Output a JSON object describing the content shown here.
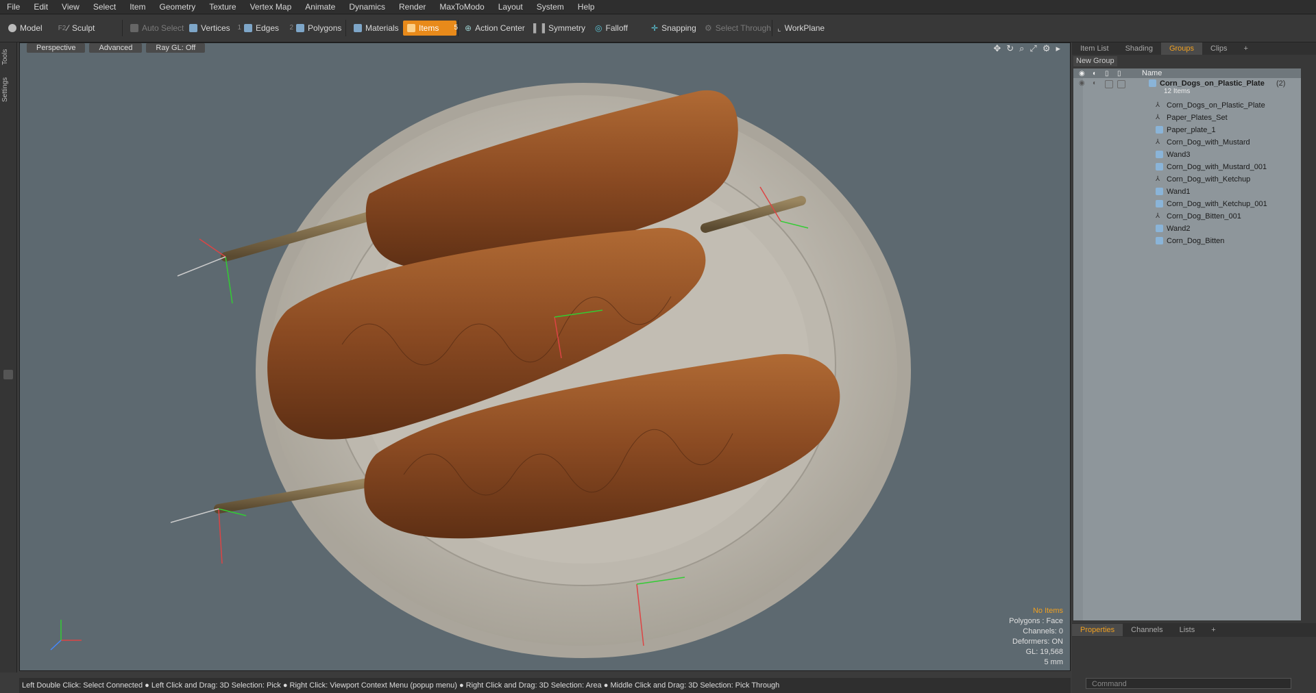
{
  "menu": [
    "File",
    "Edit",
    "View",
    "Select",
    "Item",
    "Geometry",
    "Texture",
    "Vertex Map",
    "Animate",
    "Dynamics",
    "Render",
    "MaxToModo",
    "Layout",
    "System",
    "Help"
  ],
  "toolbar": {
    "model": "Model",
    "model_key": "F2",
    "sculpt": "Sculpt",
    "auto_select": "Auto Select",
    "vertices": "Vertices",
    "vertices_num": "1",
    "edges": "Edges",
    "edges_num": "2",
    "polygons": "Polygons",
    "materials": "Materials",
    "items": "Items",
    "items_num": "5",
    "action_center": "Action Center",
    "symmetry": "Symmetry",
    "falloff": "Falloff",
    "snapping": "Snapping",
    "select_through": "Select Through",
    "workplane": "WorkPlane"
  },
  "lefttabs": [
    "Tools",
    "Settings"
  ],
  "viewport": {
    "mode": "Perspective",
    "shading": "Advanced",
    "raygl": "Ray GL: Off",
    "stats": {
      "items": "No Items",
      "polygons": "Polygons : Face",
      "channels": "Channels: 0",
      "deformers": "Deformers: ON",
      "gl": "GL: 19,568",
      "scale": "5 mm"
    }
  },
  "rpanel": {
    "tabs": [
      "Item List",
      "Shading",
      "Groups",
      "Clips",
      "+"
    ],
    "active_tab": "Groups",
    "new_group": "New Group",
    "name_header": "Name",
    "root": {
      "name": "Corn_Dogs_on_Plastic_Plate",
      "count": "(2)",
      "sub": "12 Items"
    },
    "items": [
      {
        "name": "Corn_Dogs_on_Plastic_Plate",
        "type": "locator"
      },
      {
        "name": "Paper_Plates_Set",
        "type": "locator"
      },
      {
        "name": "Paper_plate_1",
        "type": "mesh"
      },
      {
        "name": "Corn_Dog_with_Mustard",
        "type": "locator"
      },
      {
        "name": "Wand3",
        "type": "mesh"
      },
      {
        "name": "Corn_Dog_with_Mustard_001",
        "type": "mesh"
      },
      {
        "name": "Corn_Dog_with_Ketchup",
        "type": "locator"
      },
      {
        "name": "Wand1",
        "type": "mesh"
      },
      {
        "name": "Corn_Dog_with_Ketchup_001",
        "type": "mesh"
      },
      {
        "name": "Corn_Dog_Bitten_001",
        "type": "locator"
      },
      {
        "name": "Wand2",
        "type": "mesh"
      },
      {
        "name": "Corn_Dog_Bitten",
        "type": "mesh"
      }
    ],
    "bottom_tabs": [
      "Properties",
      "Channels",
      "Lists",
      "+"
    ],
    "command_placeholder": "Command"
  },
  "status": "Left Double Click: Select Connected ● Left Click and Drag: 3D Selection: Pick ● Right Click: Viewport Context Menu (popup menu) ● Right Click and Drag: 3D Selection: Area ● Middle Click and Drag: 3D Selection: Pick Through",
  "colors": {
    "accent": "#e88a1a",
    "viewport_bg": "#5d6970",
    "tree_bg": "#8e969b"
  }
}
